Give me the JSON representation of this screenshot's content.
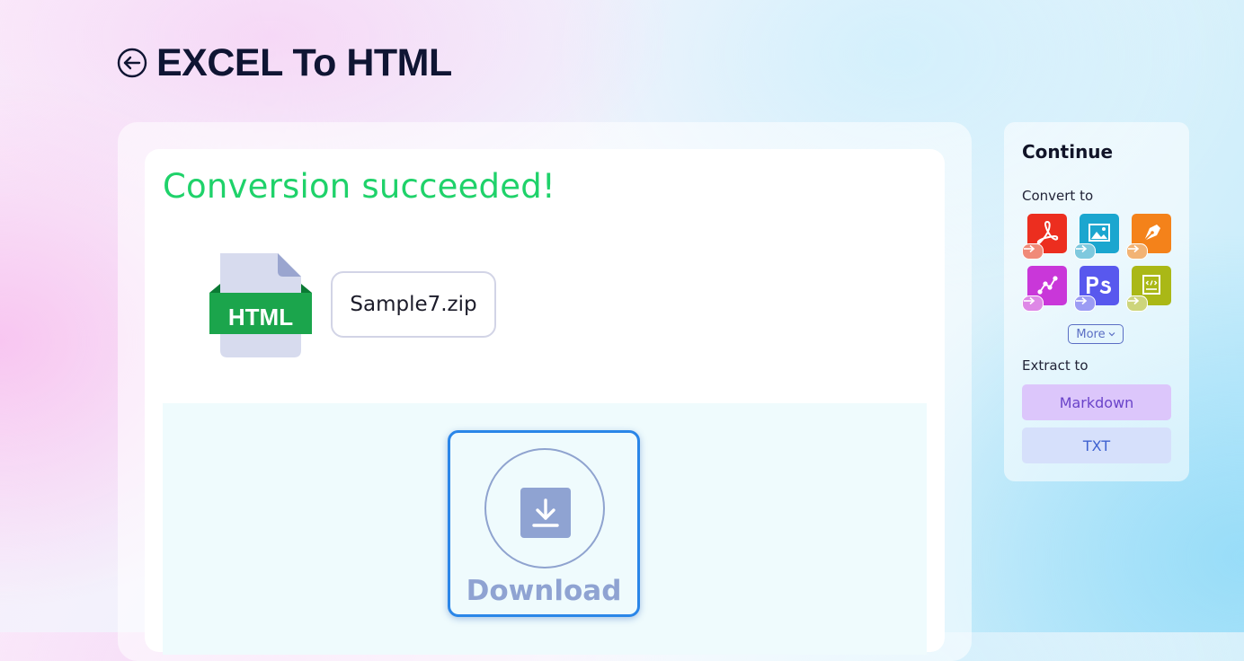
{
  "header": {
    "title": "EXCEL To HTML",
    "back_icon": "back-arrow-circle-icon"
  },
  "result": {
    "message": "Conversion succeeded!",
    "message_color": "#1fd26a",
    "file_type_label": "HTML",
    "file_name": "Sample7.zip",
    "download_label": "Download",
    "download_icon": "download-icon"
  },
  "sidebar": {
    "heading": "Continue",
    "convert_label": "Convert to",
    "convert_targets": [
      {
        "icon": "pdf-icon",
        "color": "#ec2e1f",
        "badge_color": "#f08a78"
      },
      {
        "icon": "image-icon",
        "color": "#1ba6cf",
        "badge_color": "#7fc9de"
      },
      {
        "icon": "vector-pen-icon",
        "color": "#f4821a",
        "badge_color": "#f2b374"
      },
      {
        "icon": "graph-nodes-icon",
        "color": "#c937d9",
        "badge_color": "#de88e6"
      },
      {
        "icon": "photoshop-icon",
        "color": "#5858ee",
        "badge_color": "#9c9cf4"
      },
      {
        "icon": "web-page-icon",
        "color": "#aab816",
        "badge_color": "#cdd57c"
      }
    ],
    "more_label": "More",
    "extract_label": "Extract to",
    "extract_buttons": [
      "Markdown",
      "TXT"
    ]
  }
}
